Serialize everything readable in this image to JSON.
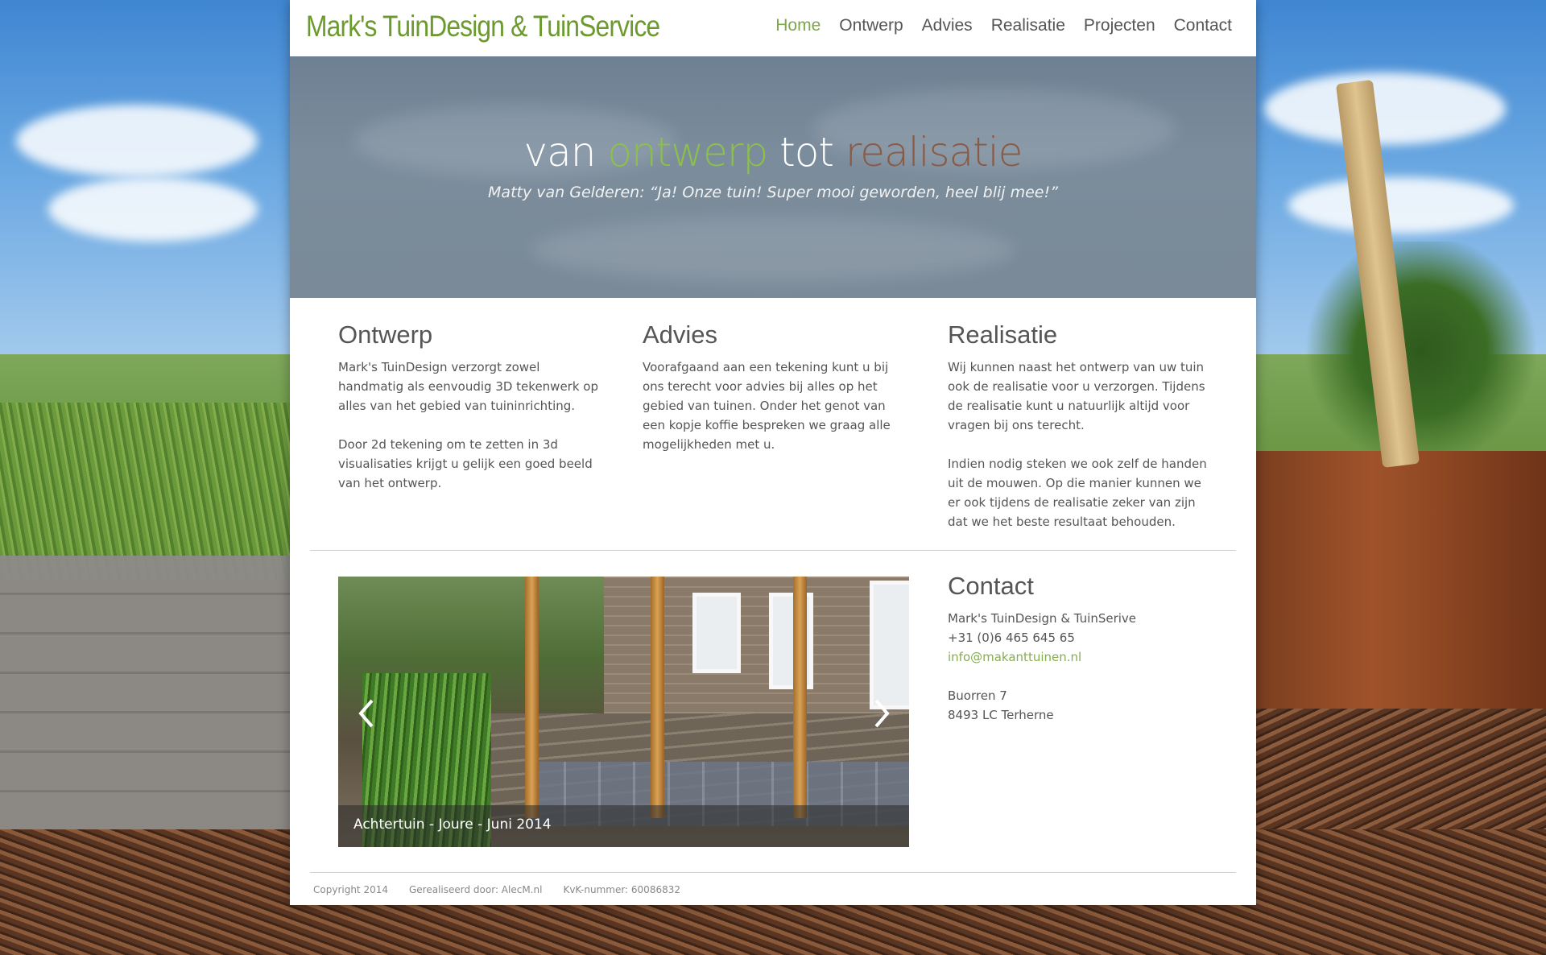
{
  "site": {
    "logo": "Mark's TuinDesign & TuinService"
  },
  "nav": {
    "items": [
      "Home",
      "Ontwerp",
      "Advies",
      "Realisatie",
      "Projecten",
      "Contact"
    ],
    "active": "Home"
  },
  "hero": {
    "title_part1": "van",
    "title_part2": "ontwerp",
    "title_part3": "tot",
    "title_part4": "realisatie",
    "quote": "Matty van Gelderen: “Ja! Onze tuin! Super mooi geworden, heel blij mee!”"
  },
  "columns": [
    {
      "heading": "Ontwerp",
      "paragraphs": [
        "Mark's TuinDesign verzorgt zowel handmatig als eenvoudig 3D tekenwerk op alles van het gebied van tuininrichting.",
        "Door 2d tekening om te zetten in 3d visualisaties krijgt u gelijk een goed beeld van het ontwerp."
      ]
    },
    {
      "heading": "Advies",
      "paragraphs": [
        "Voorafgaand aan een tekening kunt u bij ons terecht voor advies bij alles op het gebied van tuinen. Onder het genot van een kopje koffie bespreken we graag alle mogelijkheden met u."
      ]
    },
    {
      "heading": "Realisatie",
      "paragraphs": [
        "Wij kunnen naast het ontwerp van uw tuin ook de realisatie voor u verzorgen. Tijdens de realisatie kunt u natuurlijk altijd voor vragen bij ons terecht.",
        "Indien nodig steken we ook zelf de handen uit de mouwen. Op die manier kunnen we er ook tijdens de realisatie zeker van zijn dat we het beste resultaat behouden."
      ]
    }
  ],
  "slider": {
    "caption": "Achtertuin - Joure - Juni 2014",
    "prev_icon": "chevron-left-icon",
    "next_icon": "chevron-right-icon"
  },
  "contact": {
    "heading": "Contact",
    "company": "Mark's TuinDesign & TuinSerive",
    "phone": "+31 (0)6 465 645 65",
    "email": "info@makanttuinen.nl",
    "street": "Buorren 7",
    "city": "8493 LC Terherne"
  },
  "footer": {
    "copyright": "Copyright 2014",
    "credit": "Gerealiseerd door: AlecM.nl",
    "kvk": "KvK-nummer: 60086832"
  },
  "colors": {
    "brand_green": "#6d9a2e",
    "nav_active": "#7fa64a",
    "hero_green": "#8cc04a",
    "hero_brown": "#8a5a44"
  }
}
